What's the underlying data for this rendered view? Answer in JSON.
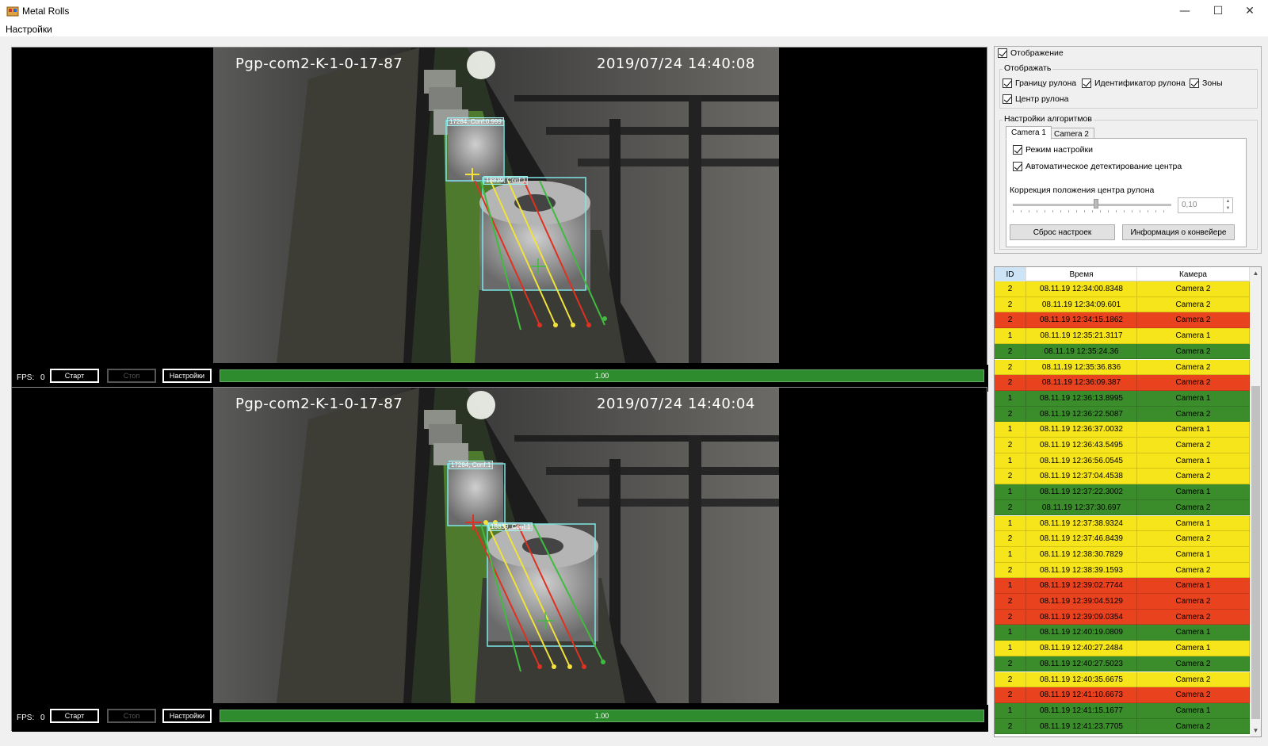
{
  "window": {
    "title": "Metal Rolls",
    "minimize": "—",
    "maximize": "☐",
    "close": "✕"
  },
  "menu": {
    "settings": "Настройки"
  },
  "cameras": [
    {
      "overlay_name": "Pgp-com2-K-1-0-17-87",
      "overlay_time": "2019/07/24  14:40:08",
      "det_top": "17284, Conf:0.999",
      "det_bottom": "18839, Conf:1",
      "fps_label": "FPS:",
      "fps_value": "0",
      "start": "Старт",
      "stop": "Стоп",
      "settings": "Настройки",
      "progress_text": "1.00",
      "progress": 1.0
    },
    {
      "overlay_name": "Pgp-com2-K-1-0-17-87",
      "overlay_time": "2019/07/24  14:40:04",
      "det_top": "17284, Conf:1",
      "det_bottom": "18839, Conf:1",
      "fps_label": "FPS:",
      "fps_value": "0",
      "start": "Старт",
      "stop": "Стоп",
      "settings": "Настройки",
      "progress_text": "1.00",
      "progress": 1.0
    }
  ],
  "settings": {
    "display": "Отображение",
    "show_group": "Отображать",
    "roll_border": "Границу рулона",
    "roll_id": "Идентификатор рулона",
    "zones": "Зоны",
    "roll_center": "Центр рулона",
    "algo_group": "Настройки алгоритмов",
    "tab1": "Camera 1",
    "tab2": "Camera 2",
    "tuning_mode": "Режим настройки",
    "auto_center": "Автоматическое детектирование центра",
    "correction_label": "Коррекция положения центра рулона",
    "correction_value": "0,10",
    "reset": "Сброс настроек",
    "conveyor_info": "Информация о конвейере"
  },
  "table": {
    "headers": {
      "id": "ID",
      "time": "Время",
      "camera": "Камера"
    },
    "colors": {
      "yellow": "#f7e51b",
      "red": "#e8421f",
      "green": "#3b8c2a"
    },
    "rows": [
      {
        "id": "2",
        "time": "08.11.19 12:34:00.8348",
        "camera": "Camera 2",
        "color": "yellow"
      },
      {
        "id": "2",
        "time": "08.11.19 12:34:09.601",
        "camera": "Camera 2",
        "color": "yellow"
      },
      {
        "id": "2",
        "time": "08.11.19 12:34:15.1862",
        "camera": "Camera 2",
        "color": "red"
      },
      {
        "id": "1",
        "time": "08.11.19 12:35:21.3117",
        "camera": "Camera 1",
        "color": "yellow"
      },
      {
        "id": "2",
        "time": "08.11.19 12:35:24.36",
        "camera": "Camera 2",
        "color": "green"
      },
      {
        "id": "2",
        "time": "08.11.19 12:35:36.836",
        "camera": "Camera 2",
        "color": "yellow"
      },
      {
        "id": "2",
        "time": "08.11.19 12:36:09.387",
        "camera": "Camera 2",
        "color": "red"
      },
      {
        "id": "1",
        "time": "08.11.19 12:36:13.8995",
        "camera": "Camera 1",
        "color": "green"
      },
      {
        "id": "2",
        "time": "08.11.19 12:36:22.5087",
        "camera": "Camera 2",
        "color": "green"
      },
      {
        "id": "1",
        "time": "08.11.19 12:36:37.0032",
        "camera": "Camera 1",
        "color": "yellow"
      },
      {
        "id": "2",
        "time": "08.11.19 12:36:43.5495",
        "camera": "Camera 2",
        "color": "yellow"
      },
      {
        "id": "1",
        "time": "08.11.19 12:36:56.0545",
        "camera": "Camera 1",
        "color": "yellow"
      },
      {
        "id": "2",
        "time": "08.11.19 12:37:04.4538",
        "camera": "Camera 2",
        "color": "yellow"
      },
      {
        "id": "1",
        "time": "08.11.19 12:37:22.3002",
        "camera": "Camera 1",
        "color": "green"
      },
      {
        "id": "2",
        "time": "08.11.19 12:37:30.697",
        "camera": "Camera 2",
        "color": "green"
      },
      {
        "id": "1",
        "time": "08.11.19 12:37:38.9324",
        "camera": "Camera 1",
        "color": "yellow"
      },
      {
        "id": "2",
        "time": "08.11.19 12:37:46.8439",
        "camera": "Camera 2",
        "color": "yellow"
      },
      {
        "id": "1",
        "time": "08.11.19 12:38:30.7829",
        "camera": "Camera 1",
        "color": "yellow"
      },
      {
        "id": "2",
        "time": "08.11.19 12:38:39.1593",
        "camera": "Camera 2",
        "color": "yellow"
      },
      {
        "id": "1",
        "time": "08.11.19 12:39:02.7744",
        "camera": "Camera 1",
        "color": "red"
      },
      {
        "id": "2",
        "time": "08.11.19 12:39:04.5129",
        "camera": "Camera 2",
        "color": "red"
      },
      {
        "id": "2",
        "time": "08.11.19 12:39:09.0354",
        "camera": "Camera 2",
        "color": "red"
      },
      {
        "id": "1",
        "time": "08.11.19 12:40:19.0809",
        "camera": "Camera 1",
        "color": "green"
      },
      {
        "id": "1",
        "time": "08.11.19 12:40:27.2484",
        "camera": "Camera 1",
        "color": "yellow"
      },
      {
        "id": "2",
        "time": "08.11.19 12:40:27.5023",
        "camera": "Camera 2",
        "color": "green"
      },
      {
        "id": "2",
        "time": "08.11.19 12:40:35.6675",
        "camera": "Camera 2",
        "color": "yellow"
      },
      {
        "id": "2",
        "time": "08.11.19 12:41:10.6673",
        "camera": "Camera 2",
        "color": "red"
      },
      {
        "id": "1",
        "time": "08.11.19 12:41:15.1677",
        "camera": "Camera 1",
        "color": "green"
      },
      {
        "id": "2",
        "time": "08.11.19 12:41:23.7705",
        "camera": "Camera 2",
        "color": "green"
      }
    ]
  }
}
